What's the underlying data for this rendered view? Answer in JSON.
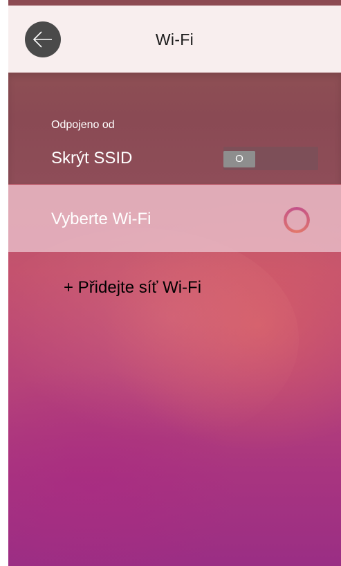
{
  "header": {
    "title": "Wi-Fi",
    "back_icon": "arrow-left-icon"
  },
  "status": {
    "text": "Odpojeno od"
  },
  "hide_ssid": {
    "label": "Skrýt SSID",
    "toggle_value": "O"
  },
  "wifi_select": {
    "label": "Vyberte Wi-Fi",
    "loading_icon": "spinner-icon"
  },
  "add_network": {
    "label": "+ Přidejte síť Wi-Fi"
  },
  "colors": {
    "accent": "#c2508a",
    "topbar": "#f8eeee",
    "back_button": "#4a4a4a"
  }
}
